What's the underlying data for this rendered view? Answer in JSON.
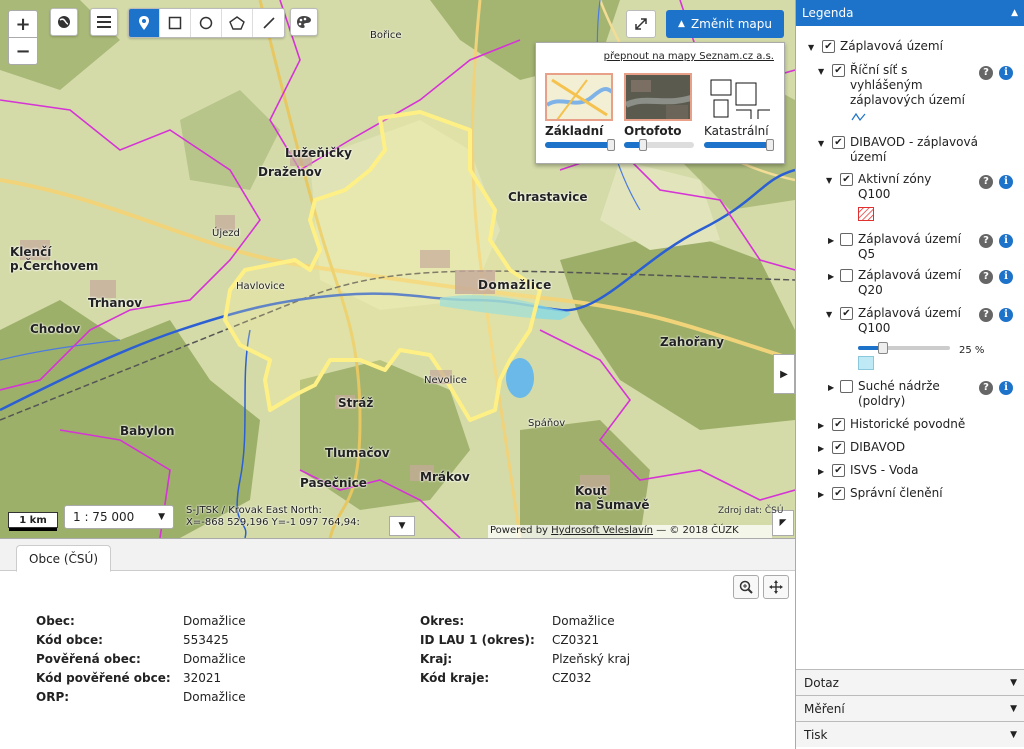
{
  "map": {
    "places": [
      {
        "name": "Klenčí pod Čerchovem",
        "lines": [
          "Klenčí",
          "p.Čerchovem"
        ]
      },
      {
        "name": "Trhanov"
      },
      {
        "name": "Chodov"
      },
      {
        "name": "Babylon"
      },
      {
        "name": "Lužeňičky"
      },
      {
        "name": "Draženov"
      },
      {
        "name": "Újezd"
      },
      {
        "name": "Havlovice"
      },
      {
        "name": "Domažlice"
      },
      {
        "name": "Chrastavice"
      },
      {
        "name": "Zahořany"
      },
      {
        "name": "Stráž"
      },
      {
        "name": "Nevolice"
      },
      {
        "name": "Tlumačov"
      },
      {
        "name": "Pasečnice"
      },
      {
        "name": "Mrákov"
      },
      {
        "name": "Kout na Šumavě",
        "lines": [
          "Kout",
          "na Šumavě"
        ]
      },
      {
        "name": "Spáňov"
      },
      {
        "name": "Bořice"
      }
    ],
    "tools": {
      "zoom_in": "+",
      "zoom_out": "−",
      "globe_icon": "globe-icon",
      "menu_icon": "menu-icon",
      "palette_icon": "palette-icon"
    },
    "draw_tools": [
      "pin-icon",
      "rectangle-icon",
      "circle-icon",
      "polygon-icon",
      "line-icon"
    ],
    "change_map_label": "Změnit mapu",
    "basemap_panel": {
      "link": "přepnout na mapy Seznam.cz a.s.",
      "options": [
        {
          "label": "Základní",
          "opacity": 1.0,
          "selected": true
        },
        {
          "label": "Ortofoto",
          "opacity": 0.25,
          "selected": true
        },
        {
          "label": "Katastrální",
          "opacity": 1.0,
          "selected": false
        }
      ]
    },
    "scale_bar": "1 km",
    "scale_value": "1 : 75 000",
    "coords_line1": "S-JTSK / Krovak East North:",
    "coords_line2": "X=-868 529,196 Y=-1 097 764,94:",
    "attribution_prefix": "Powered by ",
    "attribution_link": "Hydrosoft Veleslavín",
    "attribution_suffix": " — © 2018 ČÚZK",
    "source_note": "Zdroj dat: ČSÚ"
  },
  "bottom_panel": {
    "tab": "Obce (ČSÚ)",
    "left": [
      {
        "key": "Obec:",
        "value": "Domažlice"
      },
      {
        "key": "Kód obce:",
        "value": "553425"
      },
      {
        "key": "Pověřená obec:",
        "value": "Domažlice"
      },
      {
        "key": "Kód pověřené obce:",
        "value": "32021"
      },
      {
        "key": "ORP:",
        "value": "Domažlice"
      }
    ],
    "right": [
      {
        "key": "Okres:",
        "value": "Domažlice"
      },
      {
        "key": "ID LAU 1 (okres):",
        "value": "CZ0321"
      },
      {
        "key": "Kraj:",
        "value": "Plzeňský kraj"
      },
      {
        "key": "Kód kraje:",
        "value": "CZ032"
      }
    ]
  },
  "legend": {
    "title": "Legenda",
    "root": {
      "label": "Záplavová území",
      "checked": true
    },
    "items": [
      {
        "label": "Říční síť s vyhlášeným záplavových území",
        "lines": [
          "Říční síť s",
          "vyhlášeným",
          "záplavových území"
        ],
        "checked": true,
        "expanded": true
      },
      {
        "label": "DIBAVOD - záplavová území",
        "lines": [
          "DIBAVOD - záplavová",
          "území"
        ],
        "checked": true,
        "expanded": true
      },
      {
        "label": "Aktivní zóny Q100",
        "lines": [
          "Aktivní zóny",
          "Q100"
        ],
        "checked": true,
        "expanded": true
      },
      {
        "label": "Záplavová území Q5",
        "lines": [
          "Záplavová území",
          "Q5"
        ],
        "checked": false,
        "expanded": false
      },
      {
        "label": "Záplavová území Q20",
        "lines": [
          "Záplavová území",
          "Q20"
        ],
        "checked": false,
        "expanded": false
      },
      {
        "label": "Záplavová území Q100",
        "lines": [
          "Záplavová území",
          "Q100"
        ],
        "checked": true,
        "expanded": true
      },
      {
        "label": "Suché nádrže (poldry)",
        "lines": [
          "Suché nádrže",
          "(poldry)"
        ],
        "checked": false,
        "expanded": false
      }
    ],
    "opacity_value": 0.25,
    "opacity_label": "25 %",
    "groups": [
      {
        "label": "Historické povodně",
        "checked": true
      },
      {
        "label": "DIBAVOD",
        "checked": true
      },
      {
        "label": "ISVS - Voda",
        "checked": true
      },
      {
        "label": "Správní členění",
        "checked": true
      }
    ],
    "accordions": [
      "Dotaz",
      "Měření",
      "Tisk"
    ],
    "colors": {
      "header": "#1d72c9",
      "river": "#1d72c9",
      "hatch": "#e03030",
      "flood": "#bfe9f5"
    }
  }
}
